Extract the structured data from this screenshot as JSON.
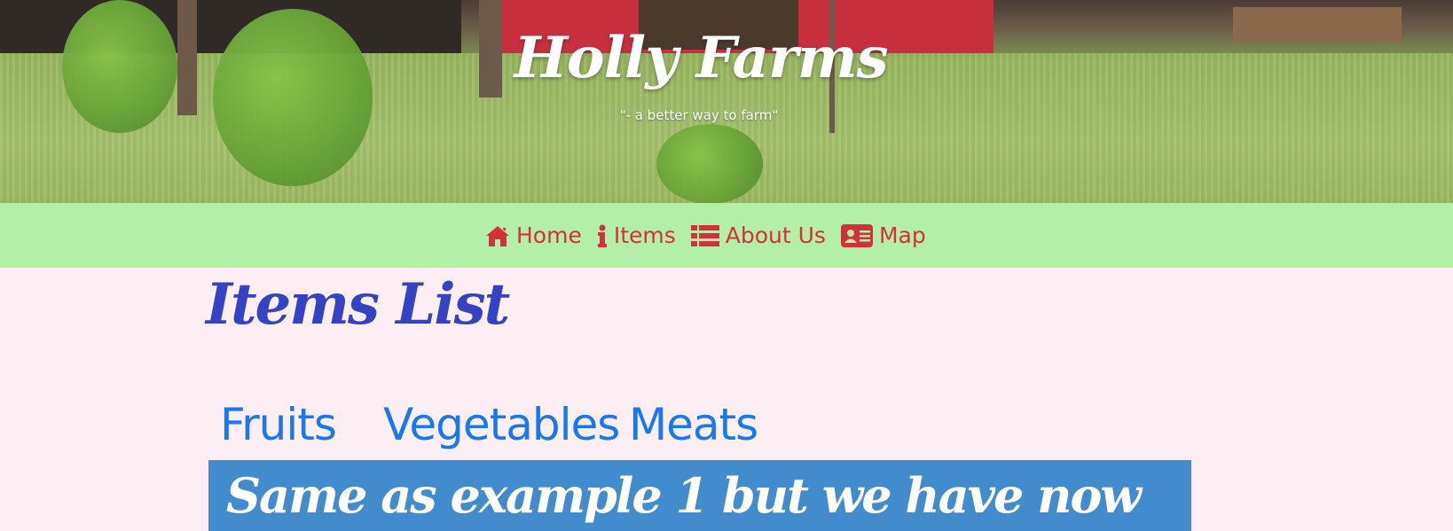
{
  "header": {
    "title": "Holly Farms",
    "tagline": "\"- a better way to farm\""
  },
  "nav": {
    "items": [
      {
        "label": "Home",
        "icon": "home-icon"
      },
      {
        "label": "Items",
        "icon": "info-icon"
      },
      {
        "label": "About Us",
        "icon": "list-icon"
      },
      {
        "label": "Map",
        "icon": "id-card-icon"
      }
    ],
    "text_color": "#d4303c",
    "background": "#b4efa8"
  },
  "main": {
    "heading": "Items List",
    "tabs": [
      {
        "label": "Fruits"
      },
      {
        "label": "Vegetables"
      },
      {
        "label": "Meats"
      }
    ],
    "panel_text": "Same as example 1 but we have now",
    "heading_color": "#3343c4",
    "tab_color": "#1878f0",
    "panel_color": "#428bcc",
    "page_background": "#fdeef3"
  }
}
